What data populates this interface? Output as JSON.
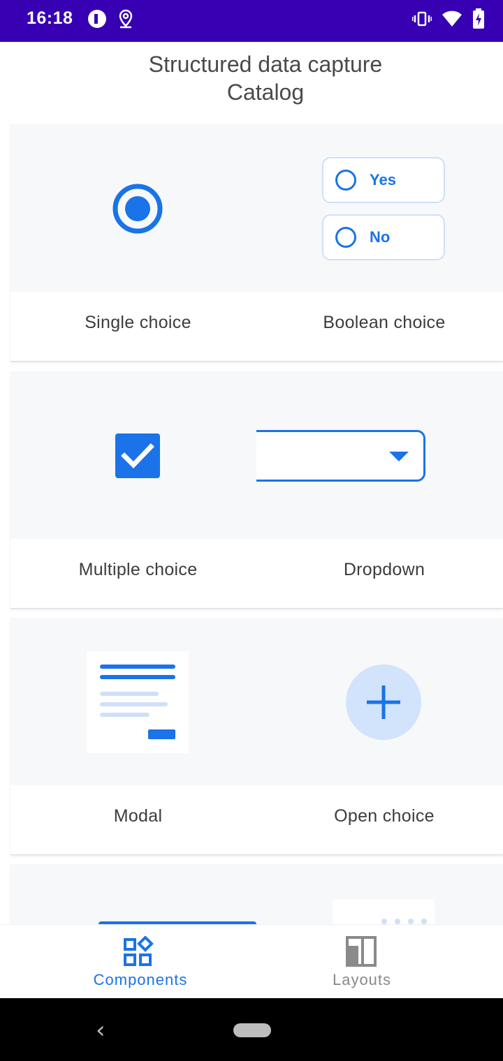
{
  "status_bar": {
    "time": "16:18",
    "icons": [
      "app-notification-icon",
      "location-icon",
      "vibrate-icon",
      "wifi-icon",
      "battery-charging-icon"
    ]
  },
  "header": {
    "title_line1": "Structured data capture",
    "title_line2": "Catalog"
  },
  "cards": [
    {
      "left_label": "Single choice",
      "right_label": "Boolean choice"
    },
    {
      "left_label": "Multiple choice",
      "right_label": "Dropdown"
    },
    {
      "left_label": "Modal",
      "right_label": "Open choice"
    }
  ],
  "boolean_options": {
    "yes": "Yes",
    "no": "No"
  },
  "bottom_nav": {
    "components": "Components",
    "layouts": "Layouts",
    "selected": "components"
  },
  "colors": {
    "status_bar": "#3700b3",
    "accent": "#1a73e8",
    "preview_bg": "#f7f8fa",
    "nav_inactive": "#888888"
  }
}
